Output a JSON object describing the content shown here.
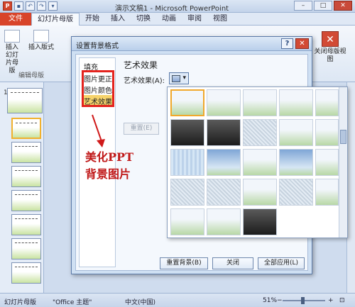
{
  "titlebar": {
    "app_icon": "P",
    "title": "演示文稿1 - Microsoft PowerPoint",
    "controls": {
      "min": "–",
      "max": "□",
      "close": "✕"
    }
  },
  "tabs": [
    "文件",
    "幻灯片母版",
    "开始",
    "插入",
    "切换",
    "动画",
    "审阅",
    "视图"
  ],
  "ribbon": {
    "insert_slide_master": "插入幻灯片母版",
    "insert_layout": "插入版式",
    "group_label": "编辑母版",
    "close_view": "关闭母版视图"
  },
  "thumbs": {
    "first_number": "1"
  },
  "dialog": {
    "title": "设置背景格式",
    "help": "?",
    "close": "✕",
    "nav": [
      "填充",
      "图片更正",
      "图片颜色",
      "艺术效果"
    ],
    "panel_title": "艺术效果",
    "effect_label": "艺术效果(A):",
    "reset_effect": "重置(E)",
    "buttons": {
      "reset_bg": "重置背景(B)",
      "close": "关闭",
      "apply_all": "全部应用(L)"
    }
  },
  "annotation": {
    "line1": "美化PPT",
    "line2": "背景图片"
  },
  "statusbar": {
    "view": "幻灯片母版",
    "theme": "\"Office 主题\"",
    "lang": "中文(中国)",
    "zoom": "51%",
    "zoom_minus": "−",
    "zoom_plus": "+"
  }
}
